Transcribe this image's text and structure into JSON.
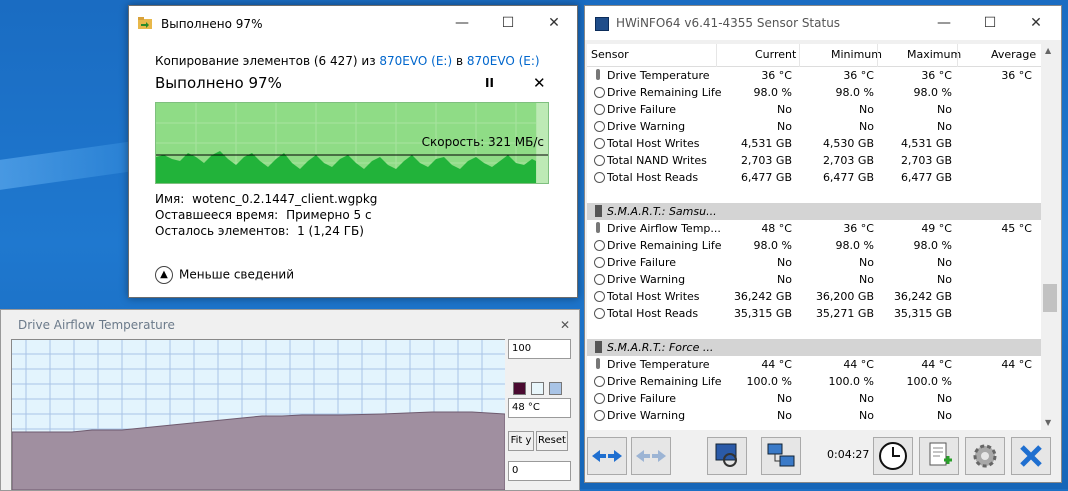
{
  "copy_dialog": {
    "title": "Выполнено 97%",
    "line_prefix": "Копирование элементов (6 427) из ",
    "source": "870EVO (E:)",
    "line_mid": " в ",
    "dest": "870EVO (E:)",
    "status": "Выполнено 97%",
    "pause_label": "II",
    "close_label": "✕",
    "progress": 0.97,
    "speed": "Скорость: 321 МБ/с",
    "name_label": "Имя:",
    "name_value": "wotenc_0.2.1447_client.wgpkg",
    "time_label": "Оставшееся время:",
    "time_value": "Примерно 5 с",
    "items_label": "Осталось элементов:",
    "items_value": "1 (1,24 ГБ)",
    "less_details": "Меньше сведений",
    "accent": "#0066cc"
  },
  "graph_window": {
    "title": "Drive Airflow Temperature",
    "max_value": "100",
    "current_value": "48 °C",
    "fit_button": "Fit y",
    "reset_button": "Reset",
    "min_value": "0",
    "swatches": [
      "#4a0a30",
      "#e8f6fb",
      "#a9c4e6"
    ]
  },
  "hwinfo": {
    "title": "HWiNFO64 v6.41-4355 Sensor Status",
    "headers": [
      "Sensor",
      "Current",
      "Minimum",
      "Maximum",
      "Average"
    ],
    "rows": [
      {
        "type": "sensor",
        "icon": "therm",
        "name": "Drive Temperature",
        "cur": "36 °C",
        "min": "36 °C",
        "max": "36 °C",
        "avg": "36 °C"
      },
      {
        "type": "sensor",
        "icon": "clock",
        "name": "Drive Remaining Life",
        "cur": "98.0 %",
        "min": "98.0 %",
        "max": "98.0 %",
        "avg": ""
      },
      {
        "type": "sensor",
        "icon": "clock",
        "name": "Drive Failure",
        "cur": "No",
        "min": "No",
        "max": "No",
        "avg": ""
      },
      {
        "type": "sensor",
        "icon": "clock",
        "name": "Drive Warning",
        "cur": "No",
        "min": "No",
        "max": "No",
        "avg": ""
      },
      {
        "type": "sensor",
        "icon": "clock",
        "name": "Total Host Writes",
        "cur": "4,531 GB",
        "min": "4,530 GB",
        "max": "4,531 GB",
        "avg": ""
      },
      {
        "type": "sensor",
        "icon": "clock",
        "name": "Total NAND Writes",
        "cur": "2,703 GB",
        "min": "2,703 GB",
        "max": "2,703 GB",
        "avg": ""
      },
      {
        "type": "sensor",
        "icon": "clock",
        "name": "Total Host Reads",
        "cur": "6,477 GB",
        "min": "6,477 GB",
        "max": "6,477 GB",
        "avg": ""
      },
      {
        "type": "blank"
      },
      {
        "type": "group",
        "name": "S.M.A.R.T.: Samsu..."
      },
      {
        "type": "sensor",
        "icon": "therm",
        "name": "Drive Airflow Temp...",
        "cur": "48 °C",
        "min": "36 °C",
        "max": "49 °C",
        "avg": "45 °C"
      },
      {
        "type": "sensor",
        "icon": "clock",
        "name": "Drive Remaining Life",
        "cur": "98.0 %",
        "min": "98.0 %",
        "max": "98.0 %",
        "avg": ""
      },
      {
        "type": "sensor",
        "icon": "clock",
        "name": "Drive Failure",
        "cur": "No",
        "min": "No",
        "max": "No",
        "avg": ""
      },
      {
        "type": "sensor",
        "icon": "clock",
        "name": "Drive Warning",
        "cur": "No",
        "min": "No",
        "max": "No",
        "avg": ""
      },
      {
        "type": "sensor",
        "icon": "clock",
        "name": "Total Host Writes",
        "cur": "36,242 GB",
        "min": "36,200 GB",
        "max": "36,242 GB",
        "avg": ""
      },
      {
        "type": "sensor",
        "icon": "clock",
        "name": "Total Host Reads",
        "cur": "35,315 GB",
        "min": "35,271 GB",
        "max": "35,315 GB",
        "avg": ""
      },
      {
        "type": "blank"
      },
      {
        "type": "group",
        "name": "S.M.A.R.T.: Force ..."
      },
      {
        "type": "sensor",
        "icon": "therm",
        "name": "Drive Temperature",
        "cur": "44 °C",
        "min": "44 °C",
        "max": "44 °C",
        "avg": "44 °C"
      },
      {
        "type": "sensor",
        "icon": "clock",
        "name": "Drive Remaining Life",
        "cur": "100.0 %",
        "min": "100.0 %",
        "max": "100.0 %",
        "avg": ""
      },
      {
        "type": "sensor",
        "icon": "clock",
        "name": "Drive Failure",
        "cur": "No",
        "min": "No",
        "max": "No",
        "avg": ""
      },
      {
        "type": "sensor",
        "icon": "clock",
        "name": "Drive Warning",
        "cur": "No",
        "min": "No",
        "max": "No",
        "avg": ""
      }
    ],
    "elapsed": "0:04:27",
    "toolbar_icons": [
      "nav-arrows-icon",
      "nav-arrows-alt-icon",
      "sensor-monitor-icon",
      "network-icon",
      "clock-icon",
      "report-add-icon",
      "settings-icon",
      "close-icon"
    ]
  }
}
